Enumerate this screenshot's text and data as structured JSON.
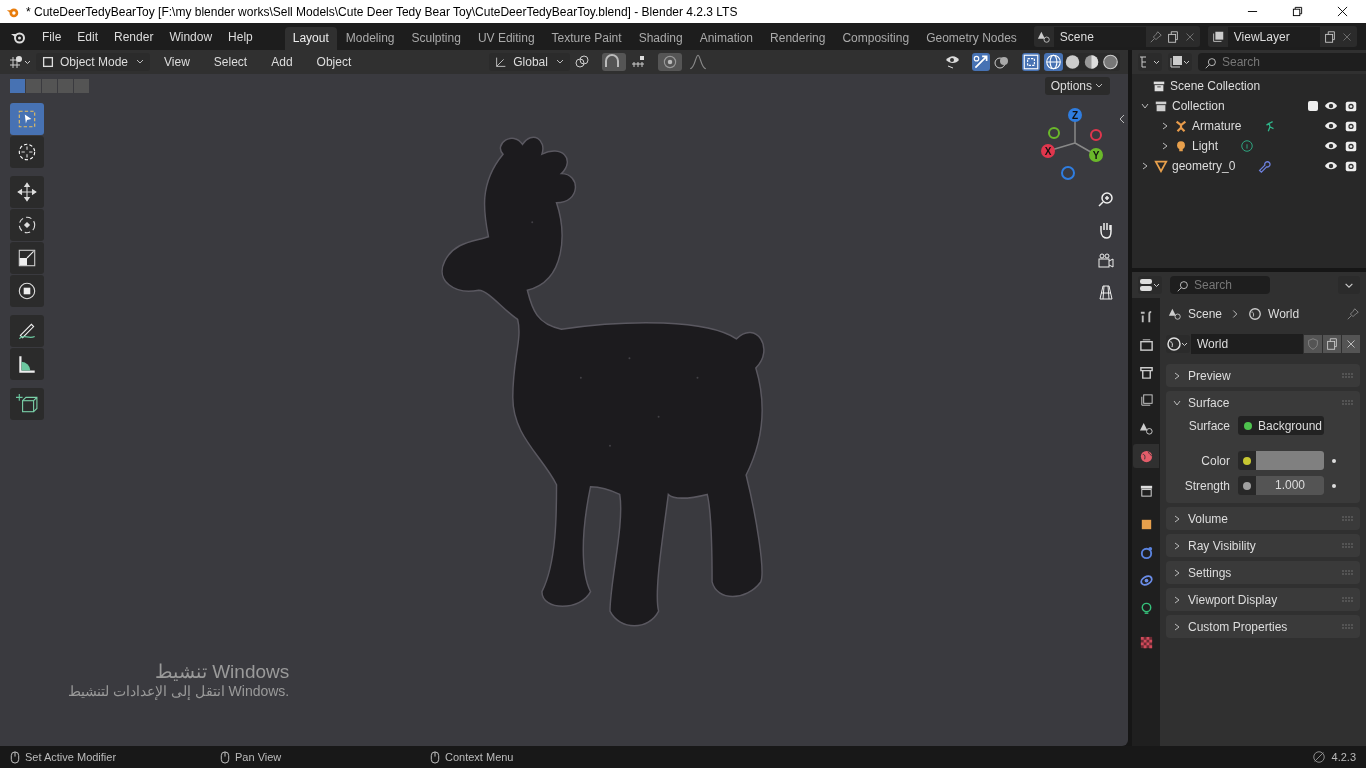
{
  "window": {
    "title": "* CuteDeerTedyBearToy [F:\\my blender works\\Sell Models\\Cute Deer Tedy Bear Toy\\CuteDeerTedyBearToy.blend] - Blender 4.2.3 LTS"
  },
  "menu": [
    "File",
    "Edit",
    "Render",
    "Window",
    "Help"
  ],
  "workspaces": [
    {
      "label": "Layout",
      "selected": true
    },
    {
      "label": "Modeling",
      "selected": false
    },
    {
      "label": "Sculpting",
      "selected": false
    },
    {
      "label": "UV Editing",
      "selected": false
    },
    {
      "label": "Texture Paint",
      "selected": false
    },
    {
      "label": "Shading",
      "selected": false
    },
    {
      "label": "Animation",
      "selected": false
    },
    {
      "label": "Rendering",
      "selected": false
    },
    {
      "label": "Compositing",
      "selected": false
    },
    {
      "label": "Geometry Nodes",
      "selected": false
    }
  ],
  "scene": {
    "name": "Scene"
  },
  "view_layer": {
    "name": "ViewLayer"
  },
  "viewport_header": {
    "mode": "Object Mode",
    "menus": [
      "View",
      "Select",
      "Add",
      "Object"
    ],
    "orientation": "Global",
    "options": "Options"
  },
  "toolbar": [
    {
      "kind": "select",
      "selected": true
    },
    {
      "kind": "cursor",
      "selected": false
    },
    {
      "kind": "move",
      "selected": false
    },
    {
      "kind": "rotate",
      "selected": false
    },
    {
      "kind": "scale",
      "selected": false
    },
    {
      "kind": "transform",
      "selected": false
    },
    {
      "kind": "annotate",
      "selected": false
    },
    {
      "kind": "measure",
      "selected": false
    },
    {
      "kind": "add",
      "selected": false
    }
  ],
  "gizmo": {
    "axes": [
      "X",
      "Y",
      "Z"
    ]
  },
  "outliner": {
    "search_placeholder": "Search",
    "root": "Scene Collection",
    "items": [
      {
        "name": "Collection",
        "kind": "collection",
        "expanded": true,
        "checked": true,
        "children": [
          {
            "name": "Armature",
            "kind": "armature",
            "expanded": false
          },
          {
            "name": "Light",
            "kind": "light",
            "expanded": false
          }
        ]
      },
      {
        "name": "geometry_0",
        "kind": "mesh",
        "expanded": false
      }
    ]
  },
  "properties": {
    "search_placeholder": "Search",
    "breadcrumb": [
      "Scene",
      "World"
    ],
    "datablock": "World",
    "tabs": [
      {
        "kind": "tool",
        "selected": false
      },
      {
        "kind": "render",
        "selected": false
      },
      {
        "kind": "output",
        "selected": false
      },
      {
        "kind": "viewlayer",
        "selected": false
      },
      {
        "kind": "scene",
        "selected": false
      },
      {
        "kind": "world",
        "selected": true
      },
      {
        "kind": "collection",
        "selected": false
      },
      {
        "kind": "object",
        "selected": false
      },
      {
        "kind": "physics",
        "selected": false
      },
      {
        "kind": "constraints",
        "selected": false
      },
      {
        "kind": "data",
        "selected": false
      },
      {
        "kind": "texture",
        "selected": false
      }
    ],
    "panels": [
      {
        "title": "Preview",
        "expanded": false
      },
      {
        "title": "Surface",
        "expanded": true,
        "fields": [
          {
            "label": "Surface",
            "kind": "shader",
            "value": "Background",
            "color": "#4ec24e"
          },
          {
            "label": "Color",
            "kind": "color",
            "color": "#c8c832"
          },
          {
            "label": "Strength",
            "kind": "number",
            "value": "1.000",
            "color": "#a0a0a0"
          }
        ]
      },
      {
        "title": "Volume",
        "expanded": false
      },
      {
        "title": "Ray Visibility",
        "expanded": false
      },
      {
        "title": "Settings",
        "expanded": false
      },
      {
        "title": "Viewport Display",
        "expanded": false
      },
      {
        "title": "Custom Properties",
        "expanded": false
      }
    ]
  },
  "overlay_notice": {
    "title": "تنشيط Windows",
    "message": "انتقل إلى الإعدادات لتنشيط Windows."
  },
  "status_bar": {
    "hints": [
      "Set Active Modifier",
      "Pan View",
      "Context Menu"
    ],
    "version": "4.2.3"
  }
}
